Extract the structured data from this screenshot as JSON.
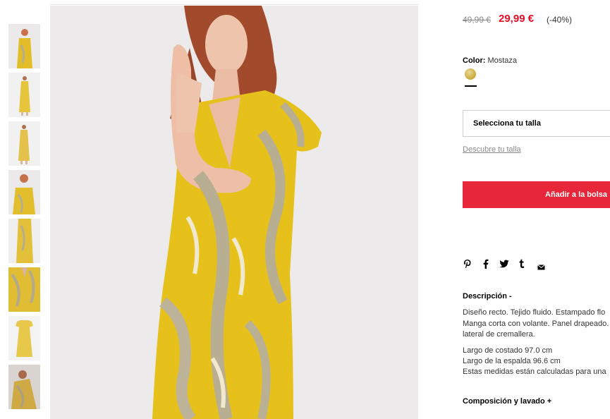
{
  "product": {
    "price_old": "49,99 €",
    "price_new": "29,99 €",
    "discount": "(-40%)",
    "color_label": "Color:",
    "color_value": "Mostaza",
    "swatch_color": "#d4b548",
    "size_select": "Selecciona tu talla",
    "size_link": "Descubre tu talla",
    "add_to_bag": "Añadir a la bolsa"
  },
  "social": {
    "icons": [
      "pinterest-icon",
      "facebook-icon",
      "twitter-icon",
      "tumblr-icon",
      "mail-icon"
    ]
  },
  "description": {
    "title": "Descripción -",
    "lines_a": [
      "Diseño recto. Tejido fluido. Estampado flo",
      "Manga corta con volante. Panel drapeado.",
      "lateral de cremallera."
    ],
    "lines_b": [
      "Largo de costado 97.0 cm",
      "Largo de la espalda 96.6 cm",
      "Estas medidas están calculadas para una"
    ]
  },
  "composition": {
    "title": "Composición y lavado +"
  },
  "colors": {
    "sale_red": "#e30d26",
    "button_red": "#e7263a",
    "dress_yellow": "#e7c21c",
    "background_grey": "#eceaeb"
  }
}
